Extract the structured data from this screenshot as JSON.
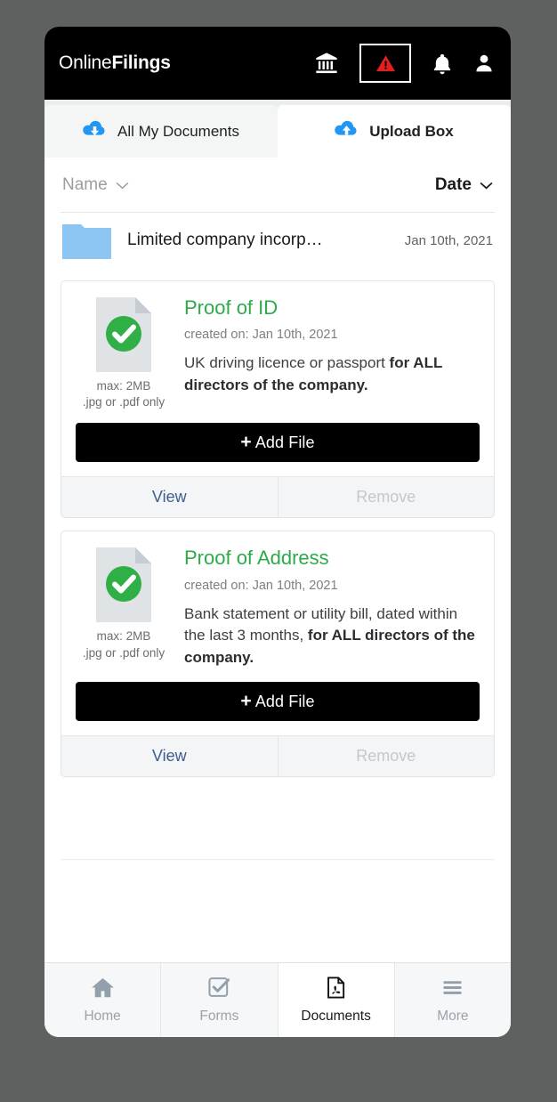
{
  "header": {
    "brand_regular": "Online",
    "brand_bold": "Filings",
    "icons": [
      {
        "name": "bank-icon",
        "label": "Bank"
      },
      {
        "name": "alert-triangle-icon",
        "label": "Alerts"
      },
      {
        "name": "bell-icon",
        "label": "Notifications"
      },
      {
        "name": "user-icon",
        "label": "Account"
      }
    ],
    "alert_color": "#e02020"
  },
  "tabs": [
    {
      "label": "All My Documents",
      "icon": "cloud-download-icon",
      "active": false
    },
    {
      "label": "Upload Box",
      "icon": "cloud-upload-icon",
      "active": true
    }
  ],
  "sortbar": {
    "name_label": "Name",
    "date_label": "Date",
    "chevron": "⌄"
  },
  "folder": {
    "name": "Limited company incorp…",
    "date": "Jan 10th, 2021",
    "color": "#8dc5f2"
  },
  "cards": [
    {
      "title": "Proof of ID",
      "created": "created on: Jan 10th, 2021",
      "desc_normal": "UK driving licence or passport ",
      "desc_bold": "for ALL directors of the company.",
      "max_size": "max: 2MB",
      "file_types": ".jpg or .pdf only",
      "add_label": "Add File",
      "plus": "+",
      "view_label": "View",
      "remove_label": "Remove",
      "status": "complete"
    },
    {
      "title": "Proof of Address",
      "created": "created on: Jan 10th, 2021",
      "desc_normal": "Bank statement or utility bill, dated within the last 3 months, ",
      "desc_bold": "for ALL directors of the company.",
      "max_size": "max: 2MB",
      "file_types": ".jpg or .pdf only",
      "add_label": "Add File",
      "plus": "+",
      "view_label": "View",
      "remove_label": "Remove",
      "status": "complete"
    }
  ],
  "navbar": [
    {
      "label": "Home",
      "icon": "home-icon",
      "active": false
    },
    {
      "label": "Forms",
      "icon": "checkbox-icon",
      "active": false
    },
    {
      "label": "Documents",
      "icon": "pdf-file-icon",
      "active": true
    },
    {
      "label": "More",
      "icon": "hamburger-menu-icon",
      "active": false
    }
  ],
  "colors": {
    "accent_green": "#2daa4a",
    "accent_blue": "#2196f3",
    "link_blue": "#3c5d8f",
    "alert_red": "#e02020",
    "black": "#000000"
  }
}
